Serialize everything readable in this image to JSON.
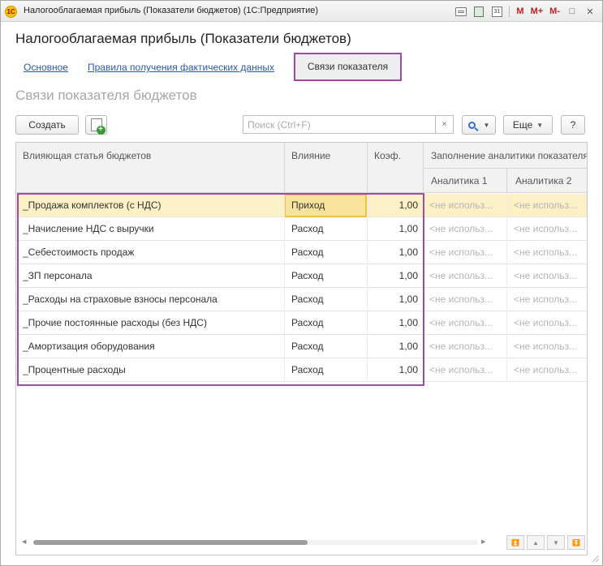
{
  "window": {
    "title": "Налогооблагаемая прибыль (Показатели бюджетов)  (1С:Предприятие)",
    "logo": "1С",
    "toolbar": {
      "m_label": "M",
      "mplus_label": "M+",
      "mminus_label": "M-",
      "restore_glyph": "□",
      "close_glyph": "✕",
      "calendar_text": "31"
    }
  },
  "header": {
    "title": "Налогооблагаемая прибыль (Показатели бюджетов)",
    "tabs": [
      {
        "label": "Основное"
      },
      {
        "label": "Правила получения фактических данных"
      },
      {
        "label": "Связи показателя"
      }
    ]
  },
  "section": {
    "title": "Связи показателя бюджетов"
  },
  "actions": {
    "create_label": "Создать",
    "search_placeholder": "Поиск (Ctrl+F)",
    "clear_glyph": "×",
    "more_label": "Еще",
    "help_label": "?"
  },
  "table": {
    "columns": {
      "article": "Влияющая статья бюджетов",
      "influence": "Влияние",
      "coef": "Коэф.",
      "analytics_group": "Заполнение аналитики показателя",
      "analytics1": "Аналитика 1",
      "analytics2": "Аналитика 2"
    },
    "na_text": "<не использ...",
    "rows": [
      {
        "article": "_Продажа комплектов (с НДС)",
        "influence": "Приход",
        "coef": "1,00"
      },
      {
        "article": "_Начисление НДС с выручки",
        "influence": "Расход",
        "coef": "1,00"
      },
      {
        "article": "_Себестоимость продаж",
        "influence": "Расход",
        "coef": "1,00"
      },
      {
        "article": "_ЗП персонала",
        "influence": "Расход",
        "coef": "1,00"
      },
      {
        "article": "_Расходы на страховые взносы персонала",
        "influence": "Расход",
        "coef": "1,00"
      },
      {
        "article": "_Прочие постоянные расходы (без НДС)",
        "influence": "Расход",
        "coef": "1,00"
      },
      {
        "article": "_Амортизация оборудования",
        "influence": "Расход",
        "coef": "1,00"
      },
      {
        "article": "_Процентные расходы",
        "influence": "Расход",
        "coef": "1,00"
      }
    ]
  },
  "colors": {
    "accent_frame": "#9b4ea0",
    "link": "#2b5aa8",
    "selected_row": "#fbf0c6",
    "current_cell": "#f8e39c"
  }
}
